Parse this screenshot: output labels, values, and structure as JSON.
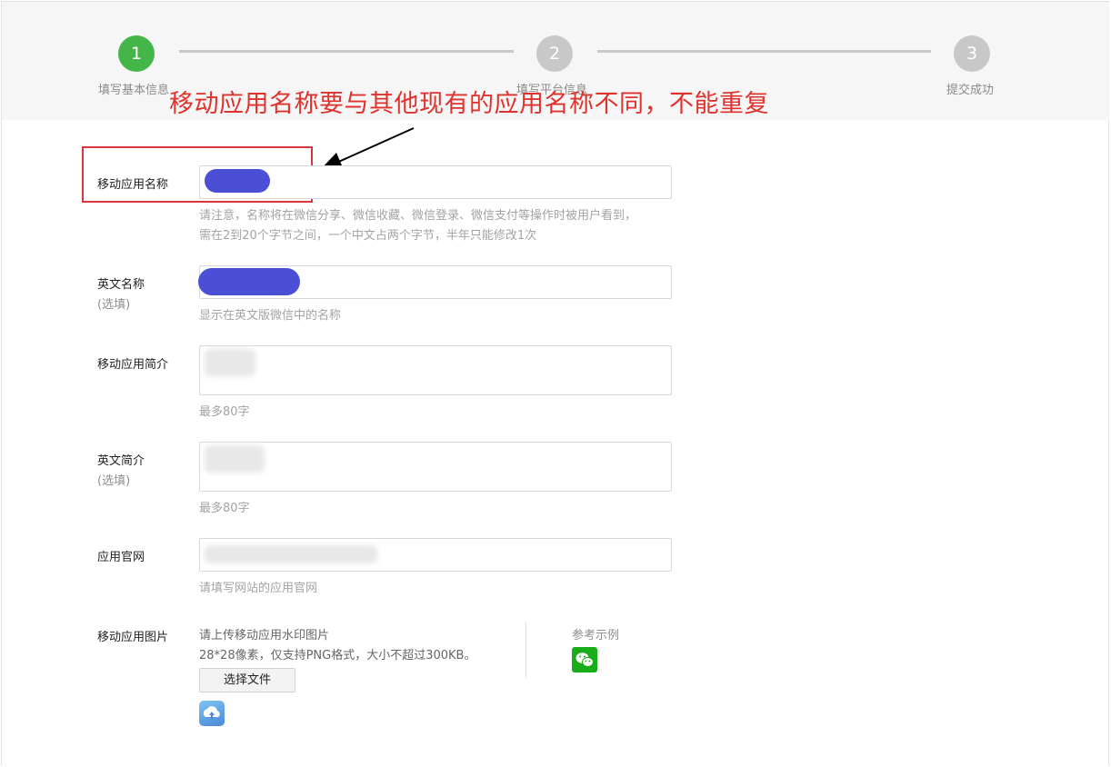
{
  "steps": [
    {
      "number": "1",
      "label": "填写基本信息",
      "color": "#44b549"
    },
    {
      "number": "2",
      "label": "填写平台信息",
      "color": "#c8c8c8"
    },
    {
      "number": "3",
      "label": "提交成功",
      "color": "#c8c8c8"
    }
  ],
  "annotation": {
    "text": "移动应用名称要与其他现有的应用名称不同，不能重复",
    "color": "#e0322c"
  },
  "form": {
    "app_name": {
      "label": "移动应用名称",
      "hint_line1": "请注意，名称将在微信分享、微信收藏、微信登录、微信支付等操作时被用户看到，",
      "hint_line2": "需在2到20个字节之间，一个中文占两个字节，半年只能修改1次"
    },
    "english_name": {
      "label": "英文名称",
      "optional": "(选填)",
      "hint": "显示在英文版微信中的名称"
    },
    "app_intro": {
      "label": "移动应用简介",
      "hint": "最多80字"
    },
    "english_intro": {
      "label": "英文简介",
      "optional": "(选填)",
      "hint": "最多80字"
    },
    "website": {
      "label": "应用官网",
      "hint": "请填写网站的应用官网"
    },
    "app_image": {
      "label": "移动应用图片",
      "upload_line1": "请上传移动应用水印图片",
      "upload_line2": "28*28像素，仅支持PNG格式，大小不超过300KB。",
      "choose_file": "选择文件",
      "reference_label": "参考示例"
    }
  },
  "colors": {
    "accent_green": "#44b549",
    "redaction_blue": "#4a4fd6",
    "wechat_green": "#19ad19"
  }
}
